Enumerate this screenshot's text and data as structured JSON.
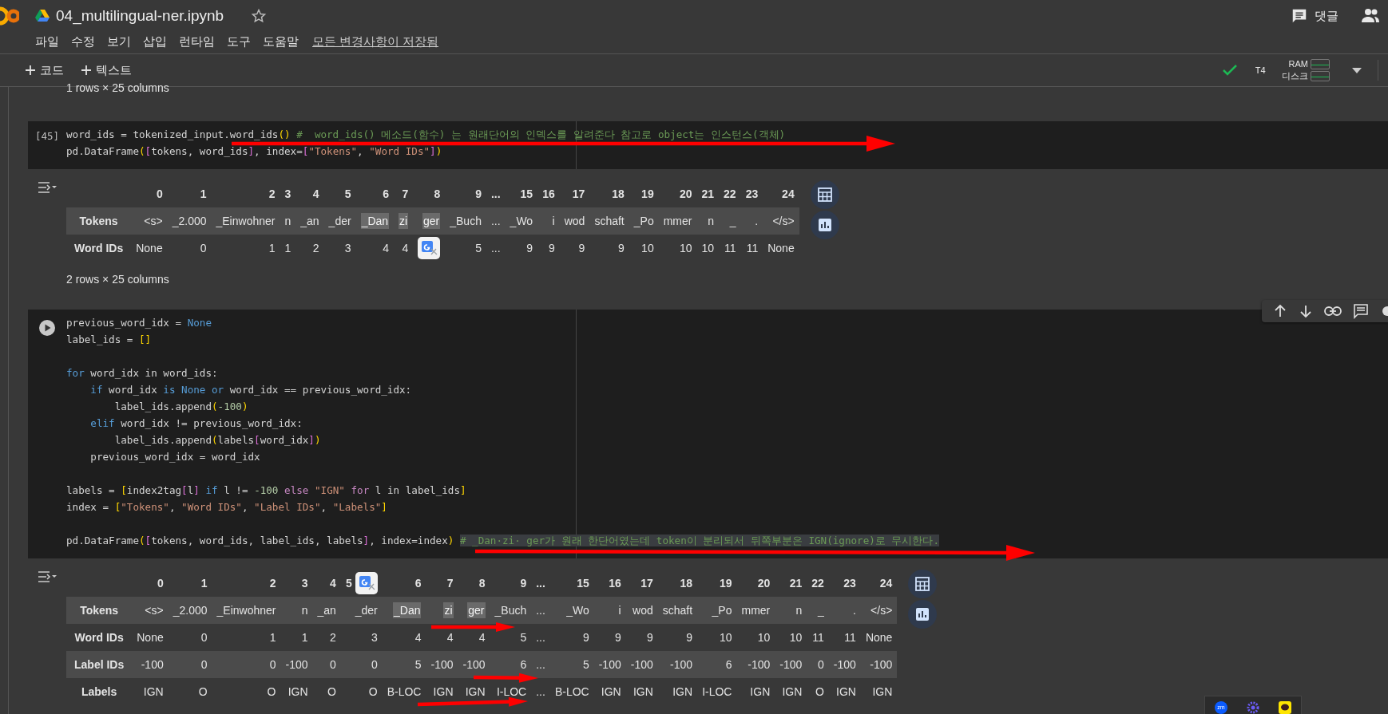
{
  "app": {
    "title": "04_multilingual-ner.ipynb",
    "menu": [
      "파일",
      "수정",
      "보기",
      "삽입",
      "런타임",
      "도구",
      "도움말"
    ],
    "save_status": "모든 변경사항이 저장됨",
    "comment_label": "댓글"
  },
  "toolbar": {
    "add_buttons": [
      "코드",
      "텍스트"
    ],
    "connected": true,
    "accelerator": "T4",
    "ram_label": "RAM",
    "disk_label": "디스크"
  },
  "top_output_note": "1 rows × 25 columns",
  "cells": [
    {
      "prompt": "[45]",
      "toolbar_visible": false,
      "lines": [
        {
          "segments": [
            {
              "kind": "plain",
              "text": "word_ids = tokenized_input.word_ids"
            },
            {
              "kind": "bracket",
              "text": "()"
            },
            {
              "kind": "comment",
              "text": " #  word_ids() 메소드(함수) 는 원래단어의 인덱스를 알려준다 참고로 object는 인스턴스(객체)"
            }
          ]
        },
        {
          "segments": [
            {
              "kind": "plain",
              "text": "pd.DataFrame"
            },
            {
              "kind": "bracket",
              "text": "("
            },
            {
              "kind": "bracket2",
              "text": "["
            },
            {
              "kind": "plain",
              "text": "tokens, word_ids"
            },
            {
              "kind": "bracket2",
              "text": "]"
            },
            {
              "kind": "plain",
              "text": ", index="
            },
            {
              "kind": "bracket2",
              "text": "["
            },
            {
              "kind": "string",
              "text": "\"Tokens\""
            },
            {
              "kind": "plain",
              "text": ", "
            },
            {
              "kind": "string",
              "text": "\"Word IDs\""
            },
            {
              "kind": "bracket2",
              "text": "]"
            },
            {
              "kind": "bracket",
              "text": ")"
            }
          ]
        }
      ],
      "output": {
        "columns": [
          "0",
          "1",
          "2",
          "3",
          "4",
          "5",
          "6",
          "7",
          "8",
          "9",
          "...",
          "15",
          "16",
          "17",
          "18",
          "19",
          "20",
          "21",
          "22",
          "23",
          "24"
        ],
        "rows": [
          {
            "label": "Tokens",
            "cells": [
              {
                "text": "<s>",
                "highlighted": false
              },
              {
                "text": "_2.000",
                "highlighted": false
              },
              {
                "text": "_Einwohner",
                "highlighted": false
              },
              {
                "text": "n",
                "highlighted": false
              },
              {
                "text": "_an",
                "highlighted": false
              },
              {
                "text": "_der",
                "highlighted": false
              },
              {
                "text": "_Dan",
                "highlighted": true
              },
              {
                "text": "zi",
                "highlighted": true
              },
              {
                "text": "ger",
                "highlighted": true
              },
              {
                "text": "_Buch",
                "highlighted": false
              },
              {
                "text": "...",
                "highlighted": false
              },
              {
                "text": "_Wo",
                "highlighted": false
              },
              {
                "text": "i",
                "highlighted": false
              },
              {
                "text": "wod",
                "highlighted": false
              },
              {
                "text": "schaft",
                "highlighted": false
              },
              {
                "text": "_Po",
                "highlighted": false
              },
              {
                "text": "mmer",
                "highlighted": false
              },
              {
                "text": "n",
                "highlighted": false
              },
              {
                "text": "_",
                "highlighted": false
              },
              {
                "text": ".",
                "highlighted": false
              },
              {
                "text": "</s>",
                "highlighted": false
              }
            ]
          },
          {
            "label": "Word IDs",
            "cells": [
              "None",
              "0",
              "1",
              "1",
              "2",
              "3",
              "4",
              "4",
              {
                "badge": true
              },
              "5",
              "...",
              "9",
              "9",
              "9",
              "9",
              "10",
              "10",
              "10",
              "11",
              "11",
              "None"
            ]
          }
        ],
        "shape": "2 rows × 25 columns"
      }
    },
    {
      "toolbar_visible": true,
      "lines": [
        {
          "segments": [
            {
              "kind": "plain",
              "text": "previous_word_idx = "
            },
            {
              "kind": "keyword",
              "text": "None"
            }
          ]
        },
        {
          "segments": [
            {
              "kind": "plain",
              "text": "label_ids = "
            },
            {
              "kind": "bracket",
              "text": "[]"
            }
          ]
        },
        {
          "gap_before": true,
          "segments": [
            {
              "kind": "keyword",
              "text": "for"
            },
            {
              "kind": "plain",
              "text": " word_idx in word_ids:"
            }
          ]
        },
        {
          "segments": [
            {
              "kind": "keyword",
              "text": "    if"
            },
            {
              "kind": "plain",
              "text": " word_idx "
            },
            {
              "kind": "keyword",
              "text": "is None or"
            },
            {
              "kind": "plain",
              "text": " word_idx == previous_word_idx:"
            }
          ]
        },
        {
          "segments": [
            {
              "kind": "plain",
              "text": "        label_ids.append"
            },
            {
              "kind": "bracket",
              "text": "("
            },
            {
              "kind": "number",
              "text": "-100"
            },
            {
              "kind": "bracket",
              "text": ")"
            }
          ]
        },
        {
          "segments": [
            {
              "kind": "keyword",
              "text": "    elif"
            },
            {
              "kind": "plain",
              "text": " word_idx != previous_word_idx:"
            }
          ]
        },
        {
          "segments": [
            {
              "kind": "plain",
              "text": "        label_ids.append"
            },
            {
              "kind": "bracket",
              "text": "("
            },
            {
              "kind": "plain",
              "text": "labels"
            },
            {
              "kind": "bracket2",
              "text": "["
            },
            {
              "kind": "plain",
              "text": "word_idx"
            },
            {
              "kind": "bracket2",
              "text": "]"
            },
            {
              "kind": "bracket",
              "text": ")"
            }
          ]
        },
        {
          "segments": [
            {
              "kind": "plain",
              "text": "    previous_word_idx = word_idx"
            }
          ]
        },
        {
          "gap_before": true,
          "segments": [
            {
              "kind": "plain",
              "text": "labels = "
            },
            {
              "kind": "bracket",
              "text": "["
            },
            {
              "kind": "plain",
              "text": "index2tag"
            },
            {
              "kind": "bracket2",
              "text": "["
            },
            {
              "kind": "plain",
              "text": "l"
            },
            {
              "kind": "bracket2",
              "text": "]"
            },
            {
              "kind": "keyword",
              "text": " if"
            },
            {
              "kind": "plain",
              "text": " l != "
            },
            {
              "kind": "number",
              "text": "-100"
            },
            {
              "kind": "keyword2",
              "text": " else"
            },
            {
              "kind": "string",
              "text": " \"IGN\""
            },
            {
              "kind": "keyword2",
              "text": " for"
            },
            {
              "kind": "plain",
              "text": " l in label_ids"
            },
            {
              "kind": "bracket",
              "text": "]"
            }
          ]
        },
        {
          "segments": [
            {
              "kind": "plain",
              "text": "index = "
            },
            {
              "kind": "bracket",
              "text": "["
            },
            {
              "kind": "string",
              "text": "\"Tokens\""
            },
            {
              "kind": "plain",
              "text": ", "
            },
            {
              "kind": "string",
              "text": "\"Word IDs\""
            },
            {
              "kind": "plain",
              "text": ", "
            },
            {
              "kind": "string",
              "text": "\"Label IDs\""
            },
            {
              "kind": "plain",
              "text": ", "
            },
            {
              "kind": "string",
              "text": "\"Labels\""
            },
            {
              "kind": "bracket",
              "text": "]"
            }
          ]
        },
        {
          "gap_before": true,
          "segments": [
            {
              "kind": "plain",
              "text": "pd.DataFrame"
            },
            {
              "kind": "bracket",
              "text": "("
            },
            {
              "kind": "bracket2",
              "text": "["
            },
            {
              "kind": "plain",
              "text": "tokens, word_ids, label_ids, labels"
            },
            {
              "kind": "bracket2",
              "text": "]"
            },
            {
              "kind": "plain",
              "text": ", index=index"
            },
            {
              "kind": "bracket",
              "text": ") "
            },
            {
              "kind": "comment_selected",
              "text": "# _Dan·zi· ger가 원래 한단어였는데 token이 분리되서 뒤쪽부분은 IGN(ignore)로 무시한다."
            }
          ]
        }
      ],
      "output": {
        "columns": [
          "0",
          "1",
          "2",
          "3",
          "4",
          {
            "text": "5",
            "badge": true
          },
          "6",
          "7",
          "8",
          "9",
          "...",
          "15",
          "16",
          "17",
          "18",
          "19",
          "20",
          "21",
          "22",
          "23",
          "24"
        ],
        "rows": [
          {
            "label": "Tokens",
            "cells": [
              {
                "text": "<s>",
                "highlighted": false
              },
              {
                "text": "_2.000",
                "highlighted": false
              },
              {
                "text": "_Einwohner",
                "highlighted": false
              },
              {
                "text": "n",
                "highlighted": false
              },
              {
                "text": "_an",
                "highlighted": false
              },
              {
                "text": "_der",
                "highlighted": false
              },
              {
                "text": "_Dan",
                "highlighted": true
              },
              {
                "text": "zi",
                "highlighted": true
              },
              {
                "text": "ger",
                "highlighted": true
              },
              {
                "text": "_Buch",
                "highlighted": false
              },
              {
                "text": "...",
                "highlighted": false
              },
              {
                "text": "_Wo",
                "highlighted": false
              },
              {
                "text": "i",
                "highlighted": false
              },
              {
                "text": "wod",
                "highlighted": false
              },
              {
                "text": "schaft",
                "highlighted": false
              },
              {
                "text": "_Po",
                "highlighted": false
              },
              {
                "text": "mmer",
                "highlighted": false
              },
              {
                "text": "n",
                "highlighted": false
              },
              {
                "text": "_",
                "highlighted": false
              },
              {
                "text": ".",
                "highlighted": false
              },
              {
                "text": "</s>",
                "highlighted": false
              }
            ]
          },
          {
            "label": "Word IDs",
            "cells": [
              "None",
              "0",
              "1",
              "1",
              "2",
              "3",
              "4",
              "4",
              "4",
              "5",
              "...",
              "9",
              "9",
              "9",
              "9",
              "10",
              "10",
              "10",
              "11",
              "11",
              "None"
            ]
          },
          {
            "label": "Label IDs",
            "cells": [
              "-100",
              "0",
              "0",
              "-100",
              "0",
              "0",
              "5",
              "-100",
              "-100",
              "6",
              "...",
              "5",
              "-100",
              "-100",
              "-100",
              "6",
              "-100",
              "-100",
              "0",
              "-100",
              "-100"
            ]
          },
          {
            "label": "Labels",
            "cells": [
              "IGN",
              "O",
              "O",
              "IGN",
              "O",
              "O",
              "B-LOC",
              "IGN",
              "IGN",
              "I-LOC",
              "...",
              "B-LOC",
              "IGN",
              "IGN",
              "IGN",
              "I-LOC",
              "IGN",
              "IGN",
              "O",
              "IGN",
              "IGN"
            ]
          }
        ]
      }
    }
  ],
  "tray": {
    "zoom_label": "zm"
  }
}
